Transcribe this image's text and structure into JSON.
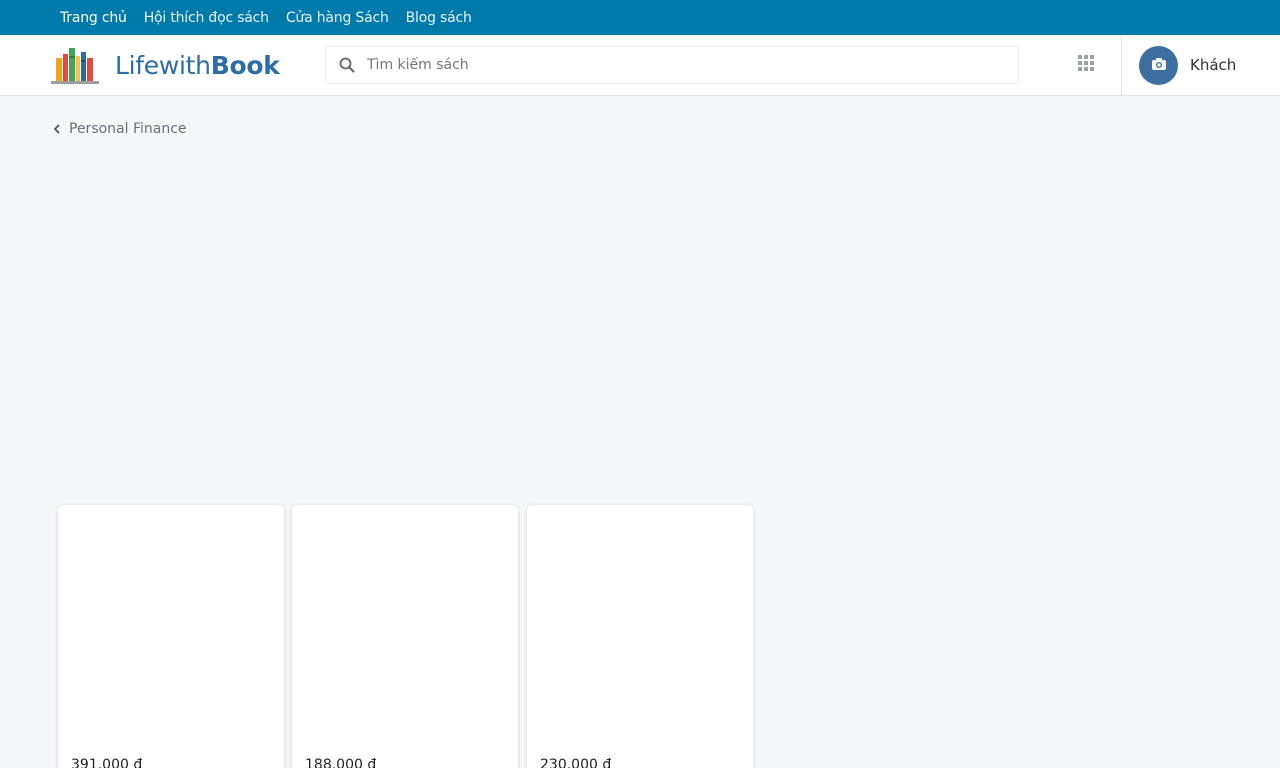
{
  "topnav": {
    "items": [
      {
        "label": "Trang chủ"
      },
      {
        "label": "Hội thích đọc sách"
      },
      {
        "label": "Cửa hàng Sách"
      },
      {
        "label": "Blog sách"
      }
    ]
  },
  "header": {
    "logo": {
      "text_light": "Lifewith",
      "text_bold": "Book",
      "icon": "bookshelf-icon"
    },
    "search": {
      "placeholder": "Tìm kiếm sách",
      "value": "",
      "icon": "search-icon"
    },
    "apps_icon": "grid-icon",
    "account": {
      "name": "Khách",
      "icon": "camera-icon"
    }
  },
  "breadcrumb": {
    "label": "Personal Finance",
    "icon": "chevron-left-icon"
  },
  "products": [
    {
      "price": "391.000 đ"
    },
    {
      "price": "188.000 đ"
    },
    {
      "price": "230.000 đ"
    }
  ],
  "colors": {
    "topbar": "#0079ab",
    "brand": "#2e6da4",
    "avatar": "#3c6e9f",
    "background": "#f5f6f8"
  }
}
